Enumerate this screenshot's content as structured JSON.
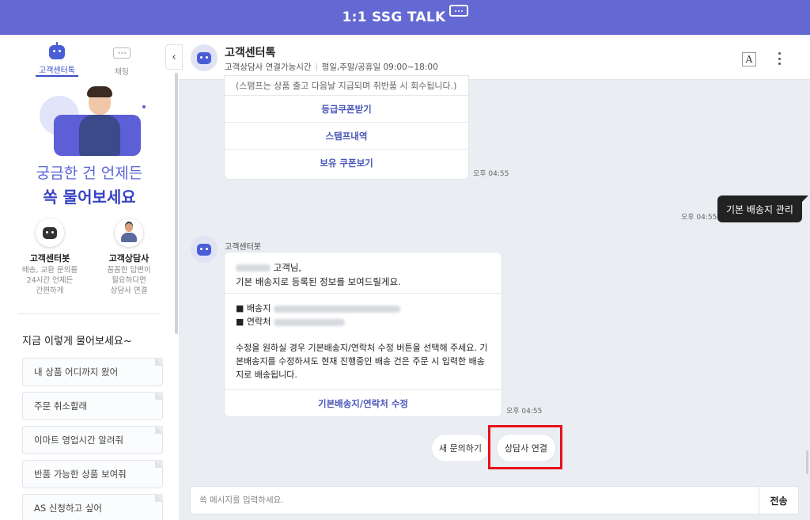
{
  "header": {
    "title": "1:1 SSG TALK"
  },
  "left": {
    "tabs": [
      {
        "label": "고객센터톡",
        "active": true
      },
      {
        "label": "채팅",
        "active": false
      }
    ],
    "hero": {
      "line1": "궁금한 건 언제든",
      "line2": "쏙 물어보세요"
    },
    "agents": [
      {
        "name": "고객센터봇",
        "desc": "배송, 교환 문의를\n24시간 언제든\n간편하게"
      },
      {
        "name": "고객상담사",
        "desc": "꼼꼼한 답변이\n필요하다면\n상담사 연결"
      }
    ],
    "suggest_title": "지금 이렇게 물어보세요~",
    "suggestions": [
      "내 상품 어디까지 왔어",
      "주문 취소할래",
      "이마트 영업시간 알려줘",
      "반품 가능한 상품 보여줘",
      "AS 신청하고 싶어"
    ]
  },
  "chat": {
    "name": "고객센터톡",
    "sub_label": "고객상담사 연결가능시간",
    "sub_hours": "평일,주말/공휴일 09:00~18:00",
    "font_btn": "A",
    "card1": {
      "note": "(스탬프는 상품 출고 다음날 지급되며 취반품 시 회수됩니다.)",
      "buttons": [
        "등급쿠폰받기",
        "스탬프내역",
        "보유 쿠폰보기"
      ],
      "time": "오후 04:55"
    },
    "user_msg": {
      "text": "기본 배송지 관리",
      "time": "오후 04:55"
    },
    "bot2": {
      "name": "고객센터봇",
      "greeting_suffix": "고객님,",
      "greeting_line2": "기본 배송지로 등록된 정보를 보여드릴게요.",
      "addr_label": "■ 배송지",
      "phone_label": "■ 연락처",
      "body": "수정을 원하실 경우 기본배송지/연락처 수정 버튼을 선택해 주세요. 기본배송지를 수정하셔도 현재 진행중인 배송 건은 주문 시 입력한 배송지로 배송됩니다.",
      "button": "기본배송지/연락처 수정",
      "time": "오후 04:55"
    },
    "quick": {
      "new_inquiry": "새 문의하기",
      "connect_agent": "상담사 연결"
    },
    "input": {
      "placeholder": "쏙 메시지를 입력하세요.",
      "send": "전송"
    }
  }
}
